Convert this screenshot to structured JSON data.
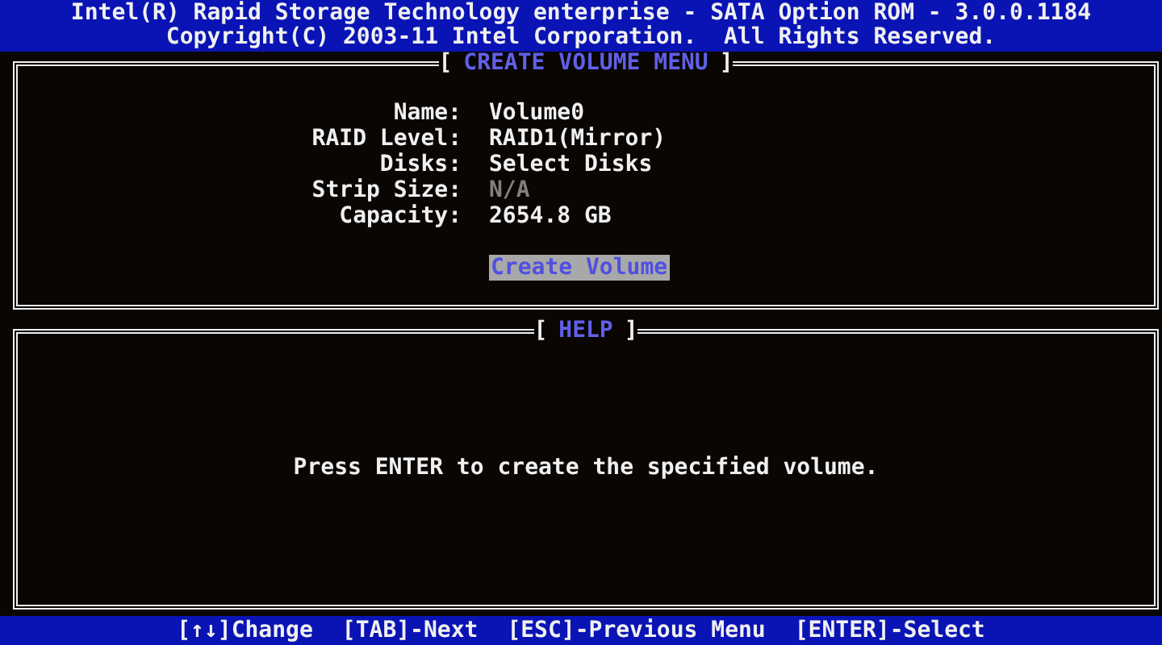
{
  "header": {
    "title": "Intel(R) Rapid Storage Technology enterprise - SATA Option ROM - 3.0.0.1184",
    "copyright": "Copyright(C) 2003-11 Intel Corporation.  All Rights Reserved."
  },
  "menu_panel": {
    "bracket_open": "[",
    "title": "CREATE VOLUME MENU",
    "bracket_close": "]",
    "fields": [
      {
        "label": "Name:",
        "value": "Volume0",
        "disabled": false
      },
      {
        "label": "RAID Level:",
        "value": "RAID1(Mirror)",
        "disabled": false
      },
      {
        "label": "Disks:",
        "value": "Select Disks",
        "disabled": false
      },
      {
        "label": "Strip Size:",
        "value": "N/A",
        "disabled": true
      },
      {
        "label": "Capacity:",
        "value": "2654.8 GB",
        "disabled": false
      }
    ],
    "action": {
      "label": "Create Volume",
      "selected": true
    }
  },
  "help_panel": {
    "bracket_open": "[",
    "title": "HELP",
    "bracket_close": "]",
    "text": "Press ENTER to create the specified volume."
  },
  "status_bar": [
    "[↑↓]Change",
    "[TAB]-Next",
    "[ESC]-Previous Menu",
    "[ENTER]-Select"
  ]
}
